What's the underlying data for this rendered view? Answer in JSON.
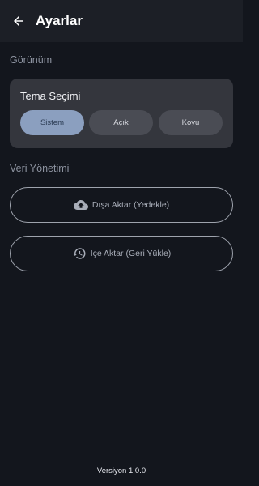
{
  "header": {
    "title": "Ayarlar",
    "back_icon": "arrow-left-icon"
  },
  "appearance": {
    "section_title": "Görünüm",
    "card_title": "Tema Seçimi",
    "options": [
      "Sistem",
      "Açık",
      "Koyu"
    ],
    "selected": "Sistem"
  },
  "data_management": {
    "section_title": "Veri Yönetimi",
    "export_label": "Dışa Aktar (Yedekle)",
    "export_icon": "cloud-upload-icon",
    "import_label": "İçe Aktar (Geri Yükle)",
    "import_icon": "restore-history-icon"
  },
  "footer": {
    "version": "Versiyon 1.0.0"
  },
  "colors": {
    "background": "#13161d",
    "app_bar": "#1c1f26",
    "card": "#34363d",
    "selected_segment": "#8b9fbf"
  }
}
